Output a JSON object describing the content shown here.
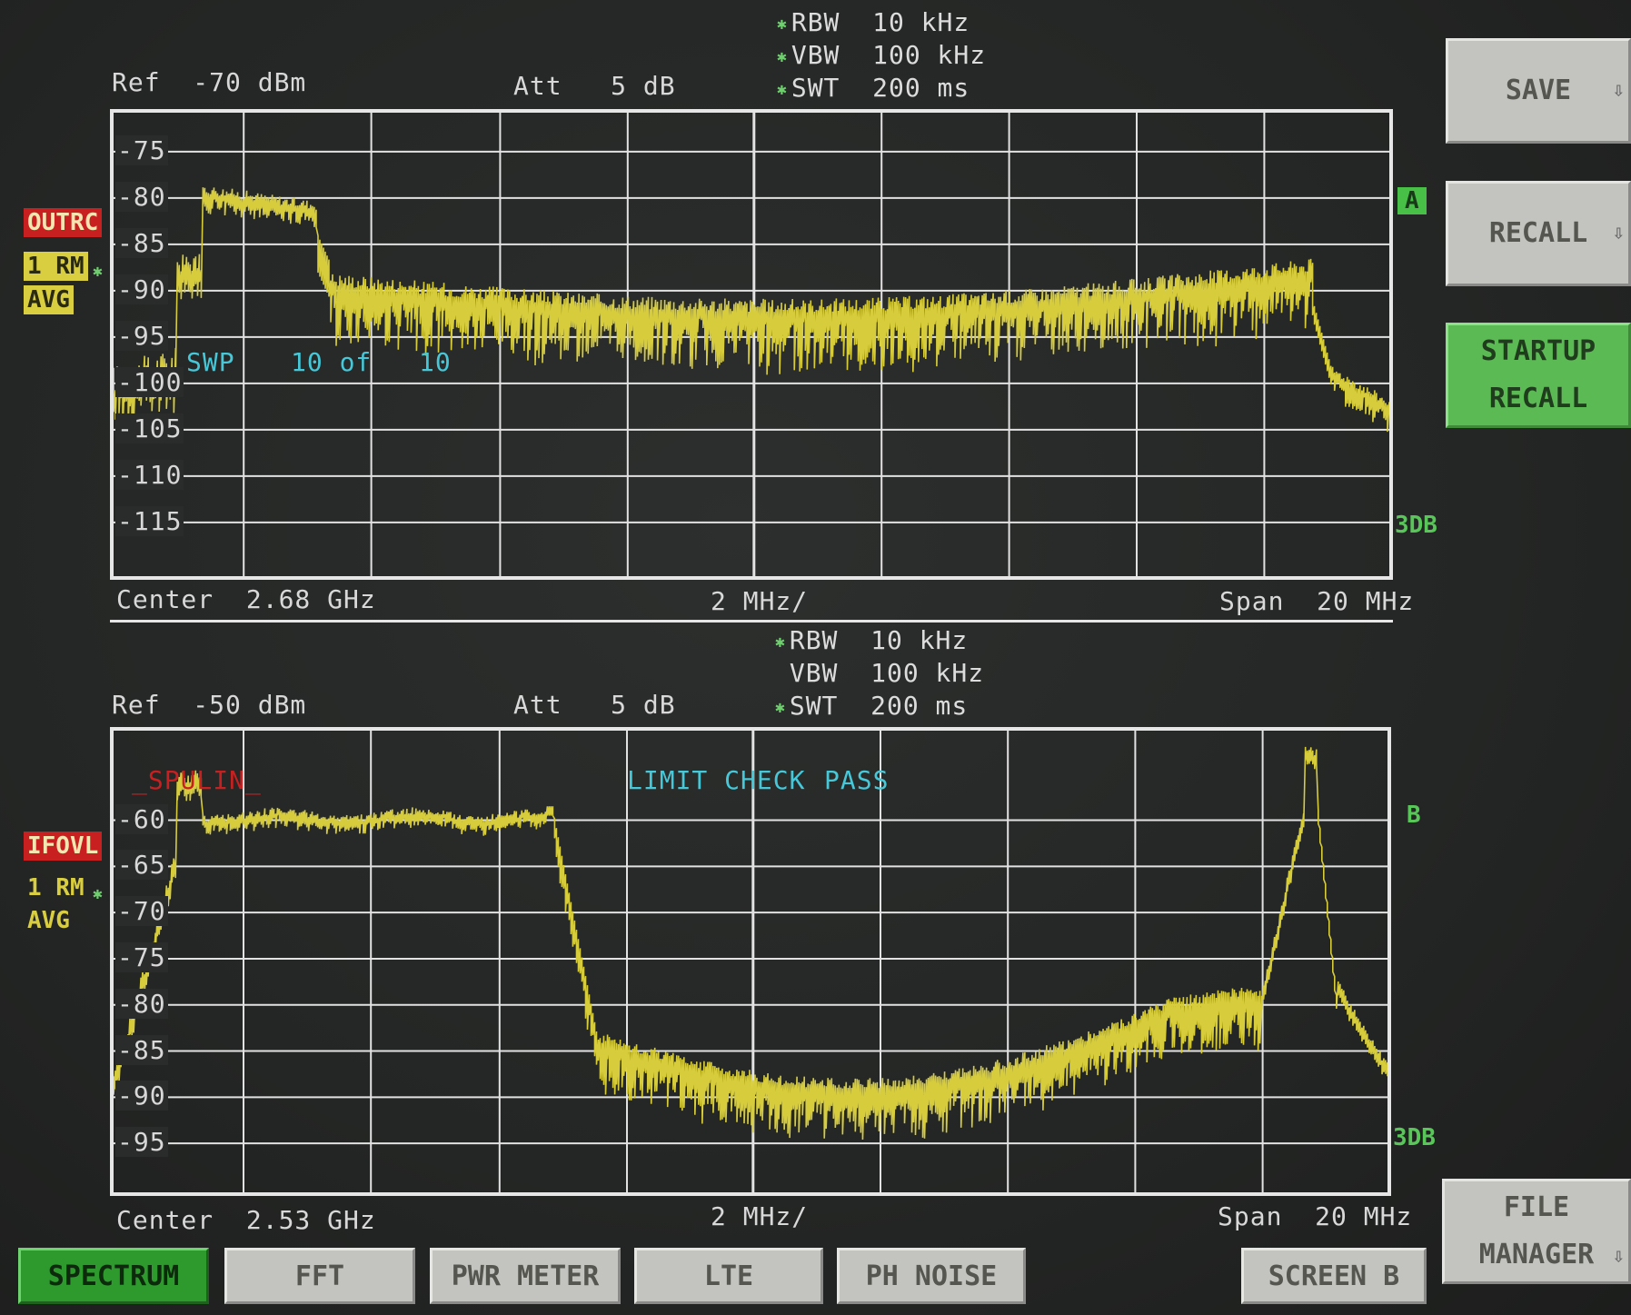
{
  "upper": {
    "rbw": "RBW  10 kHz",
    "vbw": "VBW  100 kHz",
    "swt": "SWT  200 ms",
    "ref": "Ref  -70 dBm",
    "att": "Att   5 dB",
    "trace_tag": "OUTRC",
    "trace_mode": "1 RM",
    "trace_avg": "AVG",
    "sweep_label": "SWP",
    "sweep_count": "10 of",
    "sweep_total": "10",
    "center": "Center  2.68 GHz",
    "div": "2 MHz/",
    "span": "Span  20 MHz",
    "marker": "A",
    "side_label": "3DB",
    "y_ticks": [
      "-75",
      "-80",
      "-85",
      "-90",
      "-95",
      "-100",
      "-105",
      "-110",
      "-115"
    ]
  },
  "lower": {
    "rbw": "RBW  10 kHz",
    "vbw": "VBW  100 kHz",
    "swt": "SWT  200 ms",
    "ref": "Ref  -50 dBm",
    "att": "Att   5 dB",
    "trace_tag": "IFOVL",
    "trace_mode": "1 RM",
    "trace_avg": "AVG",
    "limit_line": "_SPULIN_",
    "limit_check": "LIMIT CHECK",
    "limit_result": "PASS",
    "center": "Center  2.53 GHz",
    "div": "2 MHz/",
    "span": "Span  20 MHz",
    "marker": "B",
    "side_label": "3DB",
    "y_ticks": [
      "-60",
      "-65",
      "-70",
      "-75",
      "-80",
      "-85",
      "-90",
      "-95"
    ]
  },
  "side_buttons": {
    "save": "SAVE",
    "recall": "RECALL",
    "startup_1": "STARTUP",
    "startup_2": "RECALL",
    "file_1": "FILE",
    "file_2": "MANAGER"
  },
  "bottom_buttons": {
    "spectrum": "SPECTRUM",
    "fft": "FFT",
    "pwr_meter": "PWR METER",
    "lte": "LTE",
    "ph_noise": "PH NOISE",
    "screen_b": "SCREEN B"
  },
  "colors": {
    "trace": "#d6cc3c",
    "grid": "#e2e2e2",
    "accent_green": "#5cba55",
    "cyan_text": "#46c8d8",
    "red_tag": "#c82020"
  }
}
